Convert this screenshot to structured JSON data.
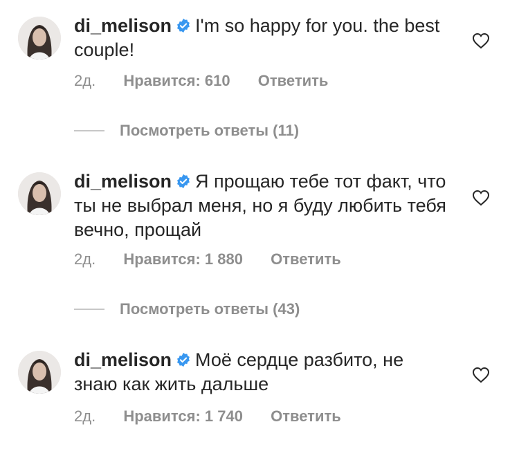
{
  "comments": [
    {
      "username": "di_melison",
      "text": "I'm so happy for you. the best couple!",
      "time": "2д.",
      "likes": "Нравится: 610",
      "reply_label": "Ответить",
      "view_replies": "Посмотреть ответы (11)"
    },
    {
      "username": "di_melison",
      "text": "Я прощаю тебе тот факт, что ты не выбрал меня, но я буду любить тебя вечно, прощай",
      "time": "2д.",
      "likes": "Нравится: 1 880",
      "reply_label": "Ответить",
      "view_replies": "Посмотреть ответы (43)"
    },
    {
      "username": "di_melison",
      "text": "Моё сердце разбито, не знаю как жить дальше",
      "time": "2д.",
      "likes": "Нравится: 1 740",
      "reply_label": "Ответить"
    }
  ],
  "icons": {
    "verified": "verified-badge-icon",
    "like": "heart-outline-icon"
  },
  "colors": {
    "text": "#262626",
    "secondary": "#8e8e8e",
    "verified_blue": "#3897f0"
  }
}
